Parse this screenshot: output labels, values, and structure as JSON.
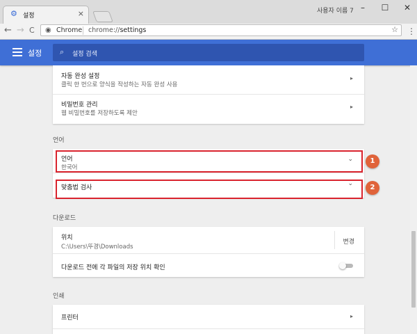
{
  "window": {
    "tab_title": "설정",
    "user_name": "사용자 이름 7",
    "tab_close": "×",
    "tab_icon": "gear-icon",
    "minimize": "–",
    "maximize": "☐",
    "close": "✕"
  },
  "toolbar": {
    "back": "←",
    "forward": "→",
    "reload": "C",
    "omnibox_label": "Chrome",
    "url_scheme": "chrome://",
    "url_host": "settings",
    "star": "☆",
    "menu": "⋮"
  },
  "header": {
    "title": "설정",
    "search_placeholder": "설정 검색"
  },
  "autofill": {
    "autofill_title": "자동 완성 설정",
    "autofill_sub": "클릭 한 번으로 양식을 작성하는 자동 완성 사용",
    "password_title": "비밀번호 관리",
    "password_sub": "웹 비밀번호를 저장하도록 제안",
    "chevron": "▸"
  },
  "language": {
    "section_label": "언어",
    "language_title": "언어",
    "language_value": "한국어",
    "spellcheck_title": "맞춤법 검사",
    "expand": "⌄",
    "badge1": "1",
    "badge2": "2"
  },
  "downloads": {
    "section_label": "다운로드",
    "location_title": "위치",
    "location_path": "C:\\Users\\뚜경\\Downloads",
    "change_button": "변경",
    "ask_label": "다운로드 전에 각 파일의 저장 위치 확인",
    "ask_enabled": false
  },
  "printing": {
    "section_label": "인쇄",
    "printer_title": "프린터",
    "chevron": "▸"
  },
  "colors": {
    "header": "#3f6fd6",
    "highlight": "#d9232d",
    "badge": "#e0633a"
  }
}
